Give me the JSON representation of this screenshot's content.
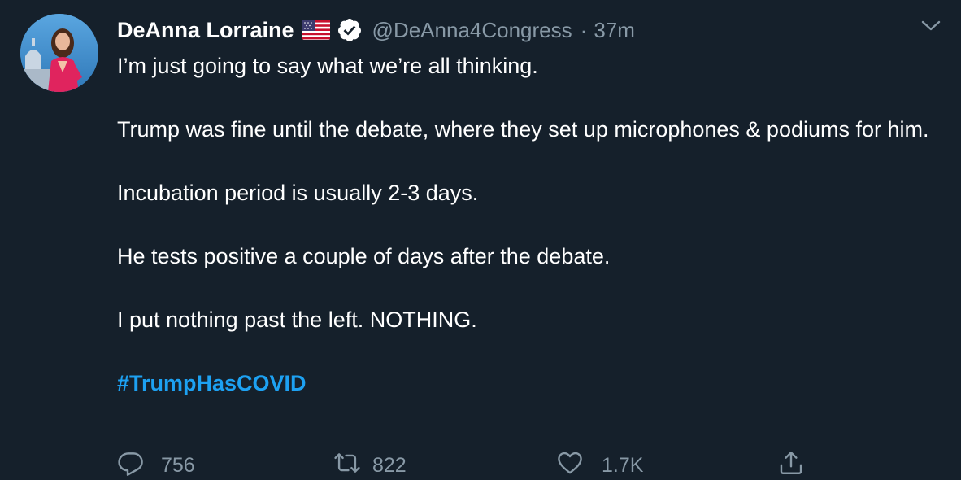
{
  "tweet": {
    "author": {
      "display_name": "DeAnna Lorraine",
      "flag_icon": "us-flag-icon",
      "verified_icon": "verified-badge-icon",
      "handle": "@DeAnna4Congress"
    },
    "separator": "·",
    "timestamp": "37m",
    "paragraphs": [
      "I’m just going to say what we’re all thinking.",
      "Trump was fine until the debate, where they set up microphones & podiums for him.",
      "Incubation period is usually 2-3 days.",
      "He tests positive a couple of days after the debate.",
      "I put nothing past the left. NOTHING."
    ],
    "hashtag": "#TrumpHasCOVID",
    "actions": {
      "reply": {
        "icon": "reply-icon",
        "count": "756"
      },
      "retweet": {
        "icon": "retweet-icon",
        "count": "822"
      },
      "like": {
        "icon": "heart-icon",
        "count": "1.7K"
      },
      "share": {
        "icon": "share-icon"
      }
    },
    "menu_icon": "chevron-down-icon"
  },
  "colors": {
    "background": "#15202b",
    "text": "#ffffff",
    "muted": "#8899a6",
    "link": "#1da1f2"
  }
}
